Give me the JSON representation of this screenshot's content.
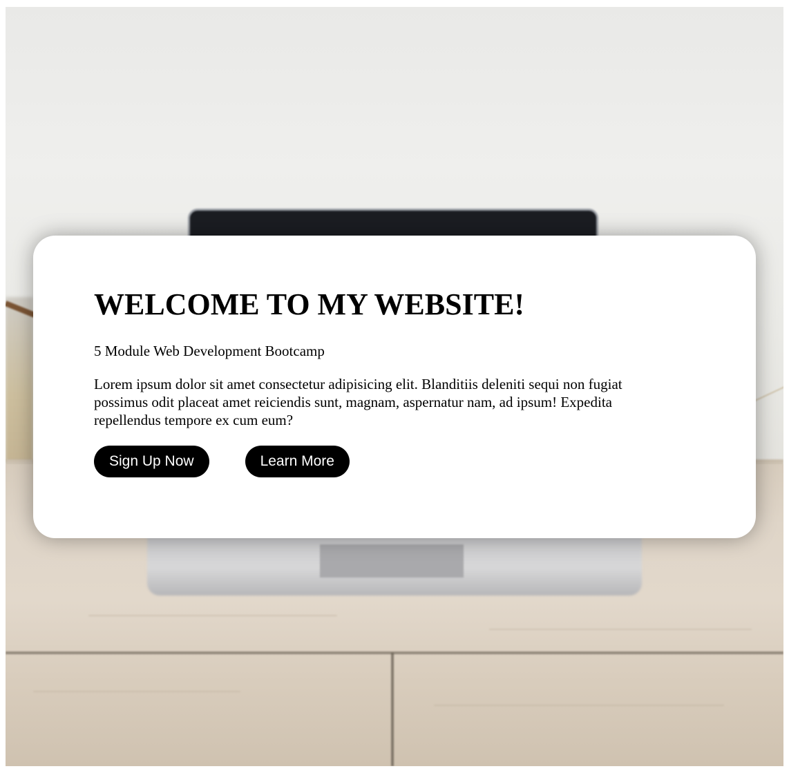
{
  "hero": {
    "title": "WELCOME TO MY WEBSITE!",
    "subtitle": "5 Module Web Development Bootcamp",
    "body": "Lorem ipsum dolor sit amet consectetur adipisicing elit. Blanditiis deleniti sequi non fugiat possimus odit placeat amet reiciendis sunt, magnam, aspernatur nam, ad ipsum! Expedita repellendus tempore ex cum eum?",
    "buttons": {
      "primary_label": "Sign Up Now",
      "secondary_label": "Learn More"
    }
  },
  "colors": {
    "card_background": "#ffffff",
    "button_background": "#000000",
    "button_text": "#ffffff",
    "text": "#000000"
  }
}
